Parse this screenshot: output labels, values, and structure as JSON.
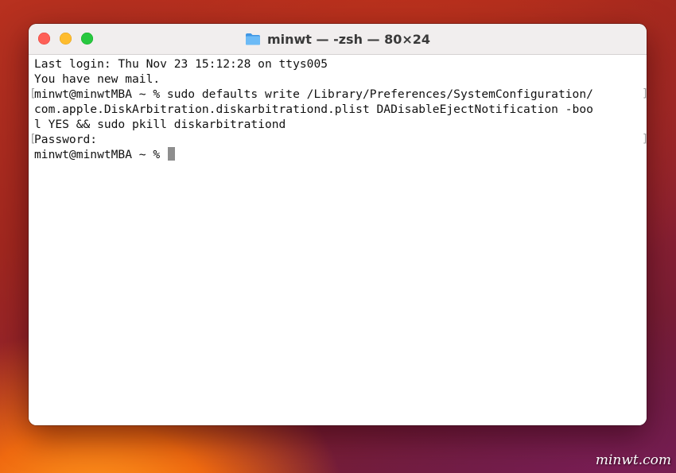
{
  "window": {
    "title": "minwt — -zsh — 80×24",
    "title_icon": "folder-icon",
    "controls": {
      "close": "close-button",
      "minimize": "minimize-button",
      "zoom": "zoom-button"
    }
  },
  "terminal": {
    "lines": [
      "Last login: Thu Nov 23 15:12:28 on ttys005",
      "You have new mail.",
      "minwt@minwtMBA ~ % sudo defaults write /Library/Preferences/SystemConfiguration/",
      "com.apple.DiskArbitration.diskarbitrationd.plist DADisableEjectNotification -boo",
      "l YES && sudo pkill diskarbitrationd",
      "Password:",
      "minwt@minwtMBA ~ % "
    ]
  },
  "watermark": "minwt.com",
  "colors": {
    "close": "#fe5f57",
    "minimize": "#febc2e",
    "zoom": "#28c840",
    "folder": "#5aaef2",
    "terminal_bg": "#ffffff",
    "terminal_text": "#111111"
  }
}
